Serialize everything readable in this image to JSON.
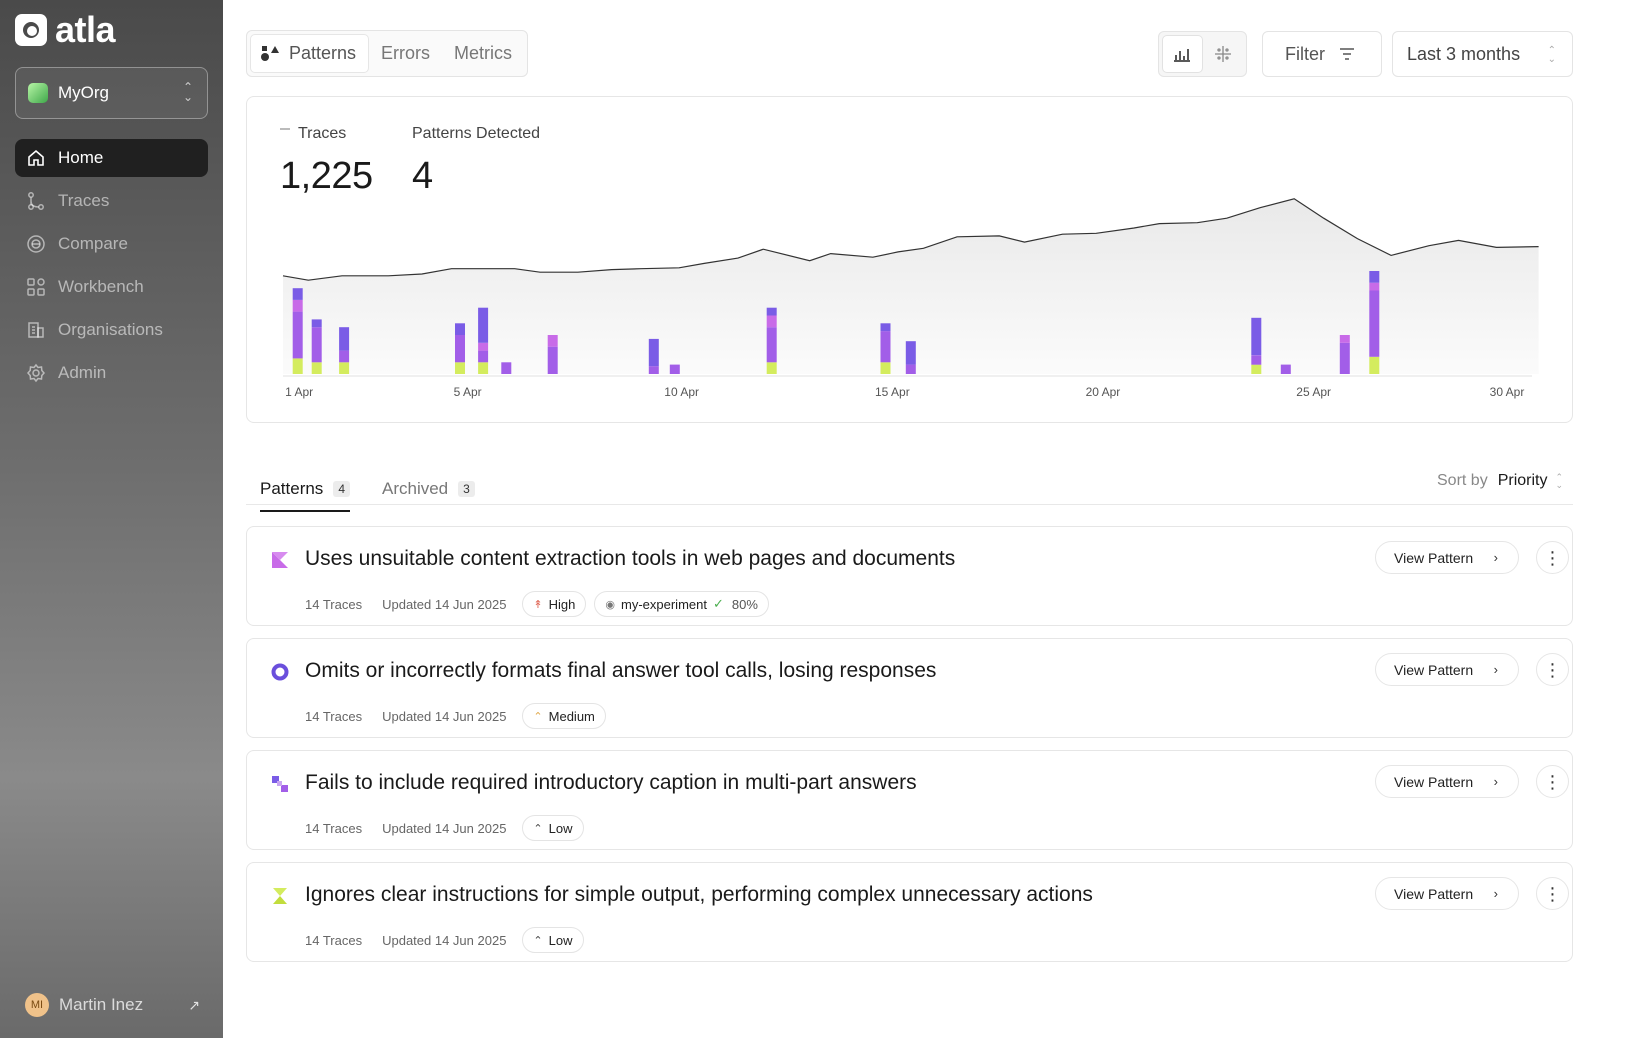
{
  "app": {
    "logo_text": "atla"
  },
  "org": {
    "name": "MyOrg"
  },
  "nav": [
    {
      "label": "Home",
      "icon": "home-icon"
    },
    {
      "label": "Traces",
      "icon": "traces-icon"
    },
    {
      "label": "Compare",
      "icon": "compare-icon"
    },
    {
      "label": "Workbench",
      "icon": "workbench-icon"
    },
    {
      "label": "Organisations",
      "icon": "organisations-icon"
    },
    {
      "label": "Admin",
      "icon": "admin-icon"
    }
  ],
  "user": {
    "initials": "MI",
    "name": "Martin Inez",
    "arrow": "↗"
  },
  "top_tabs": [
    {
      "label": "Patterns"
    },
    {
      "label": "Errors"
    },
    {
      "label": "Metrics"
    }
  ],
  "filter_label": "Filter",
  "date_range": "Last 3 months",
  "stats": {
    "traces_label": "Traces",
    "traces_value": "1,225",
    "patterns_label": "Patterns Detected",
    "patterns_value": "4"
  },
  "colors": {
    "lime": "#d4ec5e",
    "violet": "#a25ee8",
    "indigo": "#7a5ce6",
    "magenta": "#c86be8"
  },
  "chart_data": {
    "type": "bar",
    "x_ticks": [
      "1 Apr",
      "5 Apr",
      "10 Apr",
      "15 Apr",
      "20 Apr",
      "25 Apr",
      "30 Apr"
    ],
    "x_domain": [
      1,
      31
    ],
    "line": {
      "x": [
        1,
        1.6,
        2.4,
        3.5,
        4.3,
        5,
        5.8,
        6.5,
        7.1,
        8,
        8.8,
        9.5,
        10.4,
        11,
        11.8,
        12.4,
        13.5,
        14,
        15,
        15.6,
        16.2,
        17,
        18,
        18.6,
        19.5,
        20.3,
        21.2,
        21.8,
        22.7,
        23.4,
        24.2,
        25,
        25.7,
        26.5,
        27.3,
        28.2,
        28.9,
        29.8,
        30.8
      ],
      "y": [
        555,
        530,
        555,
        555,
        565,
        595,
        595,
        595,
        575,
        575,
        590,
        595,
        600,
        625,
        655,
        705,
        640,
        680,
        660,
        690,
        710,
        775,
        780,
        745,
        790,
        795,
        825,
        850,
        855,
        880,
        940,
        990,
        880,
        765,
        670,
        725,
        755,
        715,
        720
      ]
    },
    "bars": [
      {
        "x": 1.35,
        "segments": [
          {
            "color": "lime",
            "value": 20
          },
          {
            "color": "violet",
            "value": 60
          },
          {
            "color": "magenta",
            "value": 15
          },
          {
            "color": "indigo",
            "value": 15
          }
        ]
      },
      {
        "x": 1.8,
        "segments": [
          {
            "color": "lime",
            "value": 15
          },
          {
            "color": "violet",
            "value": 45
          },
          {
            "color": "indigo",
            "value": 10
          }
        ]
      },
      {
        "x": 2.45,
        "segments": [
          {
            "color": "lime",
            "value": 15
          },
          {
            "color": "violet",
            "value": 15
          },
          {
            "color": "indigo",
            "value": 30
          }
        ]
      },
      {
        "x": 5.2,
        "segments": [
          {
            "color": "lime",
            "value": 15
          },
          {
            "color": "violet",
            "value": 35
          },
          {
            "color": "indigo",
            "value": 15
          }
        ]
      },
      {
        "x": 5.75,
        "segments": [
          {
            "color": "lime",
            "value": 15
          },
          {
            "color": "violet",
            "value": 15
          },
          {
            "color": "magenta",
            "value": 10
          },
          {
            "color": "indigo",
            "value": 45
          }
        ]
      },
      {
        "x": 6.3,
        "segments": [
          {
            "color": "violet",
            "value": 15
          }
        ]
      },
      {
        "x": 7.4,
        "segments": [
          {
            "color": "violet",
            "value": 35
          },
          {
            "color": "magenta",
            "value": 15
          }
        ]
      },
      {
        "x": 9.8,
        "segments": [
          {
            "color": "violet",
            "value": 10
          },
          {
            "color": "indigo",
            "value": 35
          }
        ]
      },
      {
        "x": 10.3,
        "segments": [
          {
            "color": "violet",
            "value": 12
          }
        ]
      },
      {
        "x": 12.6,
        "segments": [
          {
            "color": "lime",
            "value": 15
          },
          {
            "color": "violet",
            "value": 45
          },
          {
            "color": "magenta",
            "value": 15
          },
          {
            "color": "indigo",
            "value": 10
          }
        ]
      },
      {
        "x": 15.3,
        "segments": [
          {
            "color": "lime",
            "value": 15
          },
          {
            "color": "violet",
            "value": 40
          },
          {
            "color": "indigo",
            "value": 10
          }
        ]
      },
      {
        "x": 15.9,
        "segments": [
          {
            "color": "violet",
            "value": 12
          },
          {
            "color": "indigo",
            "value": 30
          }
        ]
      },
      {
        "x": 24.1,
        "segments": [
          {
            "color": "lime",
            "value": 12
          },
          {
            "color": "violet",
            "value": 12
          },
          {
            "color": "indigo",
            "value": 48
          }
        ]
      },
      {
        "x": 24.8,
        "segments": [
          {
            "color": "violet",
            "value": 12
          }
        ]
      },
      {
        "x": 26.2,
        "segments": [
          {
            "color": "violet",
            "value": 40
          },
          {
            "color": "magenta",
            "value": 10
          }
        ]
      },
      {
        "x": 26.9,
        "segments": [
          {
            "color": "lime",
            "value": 22
          },
          {
            "color": "violet",
            "value": 85
          },
          {
            "color": "magenta",
            "value": 10
          },
          {
            "color": "indigo",
            "value": 15
          }
        ]
      }
    ]
  },
  "list_tabs": [
    {
      "label": "Patterns",
      "count": "4"
    },
    {
      "label": "Archived",
      "count": "3"
    }
  ],
  "sort": {
    "label": "Sort by",
    "value": "Priority"
  },
  "view_pattern_label": "View Pattern",
  "patterns": [
    {
      "icon": "triangle-flag-icon",
      "title": "Uses unsuitable content extraction tools in web pages and documents",
      "traces": "14 Traces",
      "updated": "Updated 14 Jun 2025",
      "priority": "High",
      "experiment": "my-experiment",
      "experiment_pct": "80%"
    },
    {
      "icon": "ring-icon",
      "title": "Omits or incorrectly formats final answer tool calls, losing responses",
      "traces": "14 Traces",
      "updated": "Updated 14 Jun 2025",
      "priority": "Medium"
    },
    {
      "icon": "squares-icon",
      "title": "Fails to include required introductory caption in multi-part answers",
      "traces": "14 Traces",
      "updated": "Updated 14 Jun 2025",
      "priority": "Low"
    },
    {
      "icon": "hourglass-icon",
      "title": "Ignores clear instructions for simple output, performing complex unnecessary actions",
      "traces": "14 Traces",
      "updated": "Updated 14 Jun 2025",
      "priority": "Low"
    }
  ]
}
